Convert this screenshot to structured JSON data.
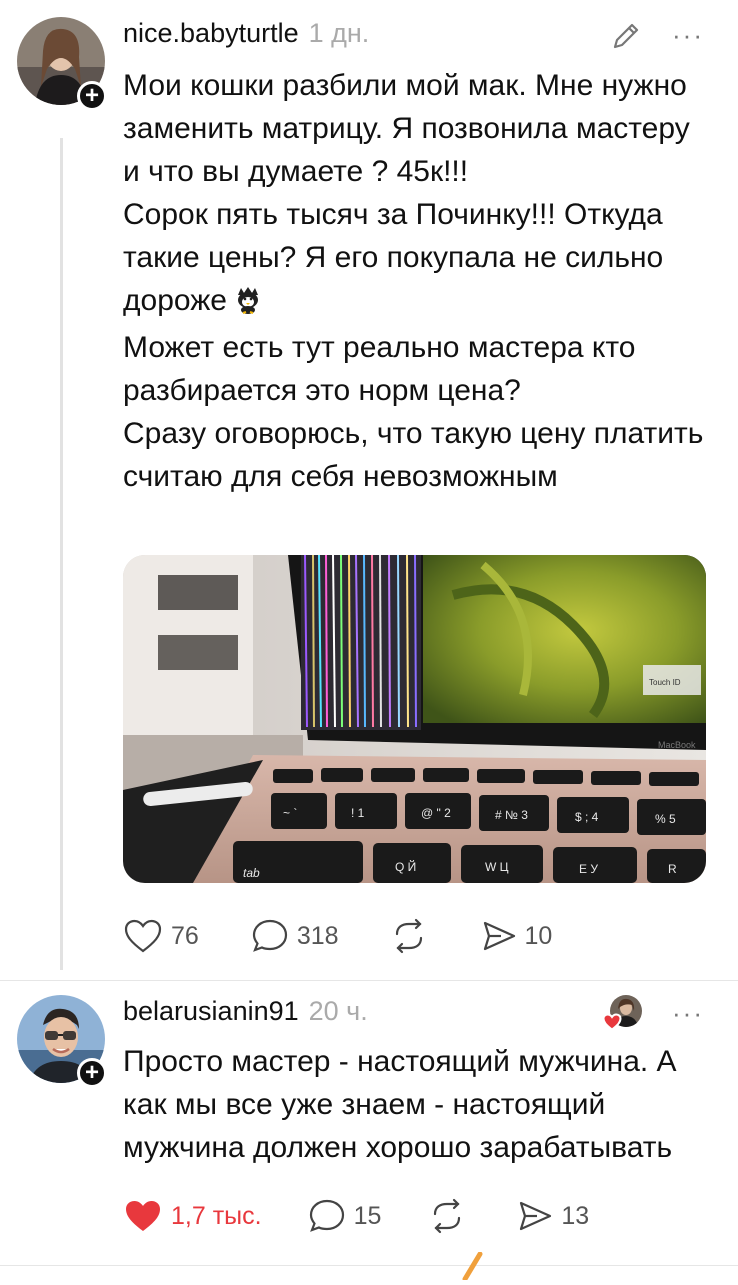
{
  "post": {
    "username": "nice.babyturtle",
    "time": "1 дн.",
    "more": "···",
    "text": {
      "line1": "Мои кошки разбили мой мак. Мне нужно заменить матрицу. Я позвонила мастеру и что вы думаете ? 45к!!!",
      "line2": "Сорок пять тысяч за Починку!!! Откуда такие цены? Я его покупала не сильно дороже",
      "line3": "Может есть тут реально мастера кто разбирается это норм цена?",
      "line4": "Сразу оговорюсь, что такую цену платить считаю для себя невозможным"
    },
    "image": {
      "keys_row1": [
        "~ `",
        "! 1",
        "@ \" 2",
        "# № 3",
        "$ ; 4",
        "% 5"
      ],
      "keys_row2": [
        "tab",
        "Q Й",
        "W Ц",
        "E У",
        "R"
      ],
      "brand": "MacBook",
      "touchid": "Touch ID"
    },
    "actions": {
      "likes": "76",
      "comments": "318",
      "shares": "10"
    }
  },
  "reply": {
    "username": "belarusianin91",
    "time": "20 ч.",
    "more": "···",
    "text": "Просто мастер - настоящий мужчина. А как мы все уже знаем - настоящий мужчина должен хорошо зарабатывать",
    "actions": {
      "likes": "1,7 тыс.",
      "comments": "15",
      "shares": "13"
    }
  },
  "colors": {
    "like_active": "#e8383d",
    "muted": "#aaaaaa",
    "icon": "#555555"
  }
}
